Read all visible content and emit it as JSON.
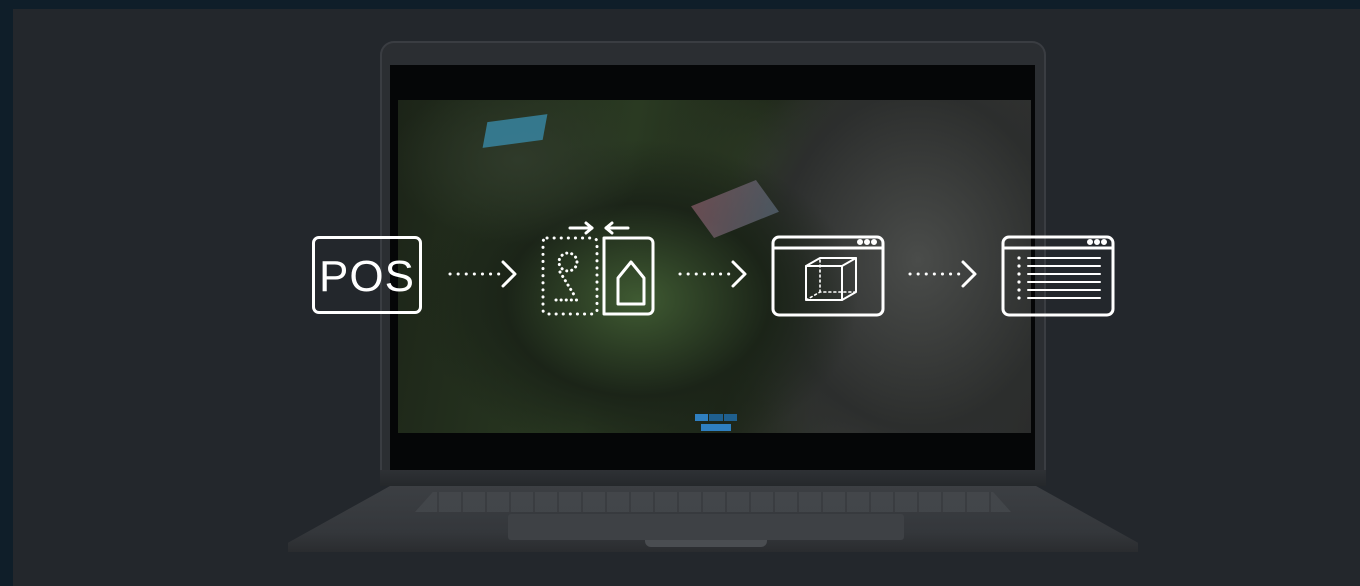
{
  "workflow": {
    "steps": [
      {
        "label": "POS",
        "icon": "pos-text-icon"
      },
      {
        "icon": "align-2d-house-icon"
      },
      {
        "icon": "browser-3d-cube-icon"
      },
      {
        "icon": "browser-list-report-icon"
      }
    ],
    "connector_icon": "dotted-arrow-icon"
  },
  "colors": {
    "page_bg": "#0f1e29",
    "stage_bg": "#23272c",
    "icon_stroke": "#ffffff",
    "accent_blue": "#2f7fc0"
  }
}
